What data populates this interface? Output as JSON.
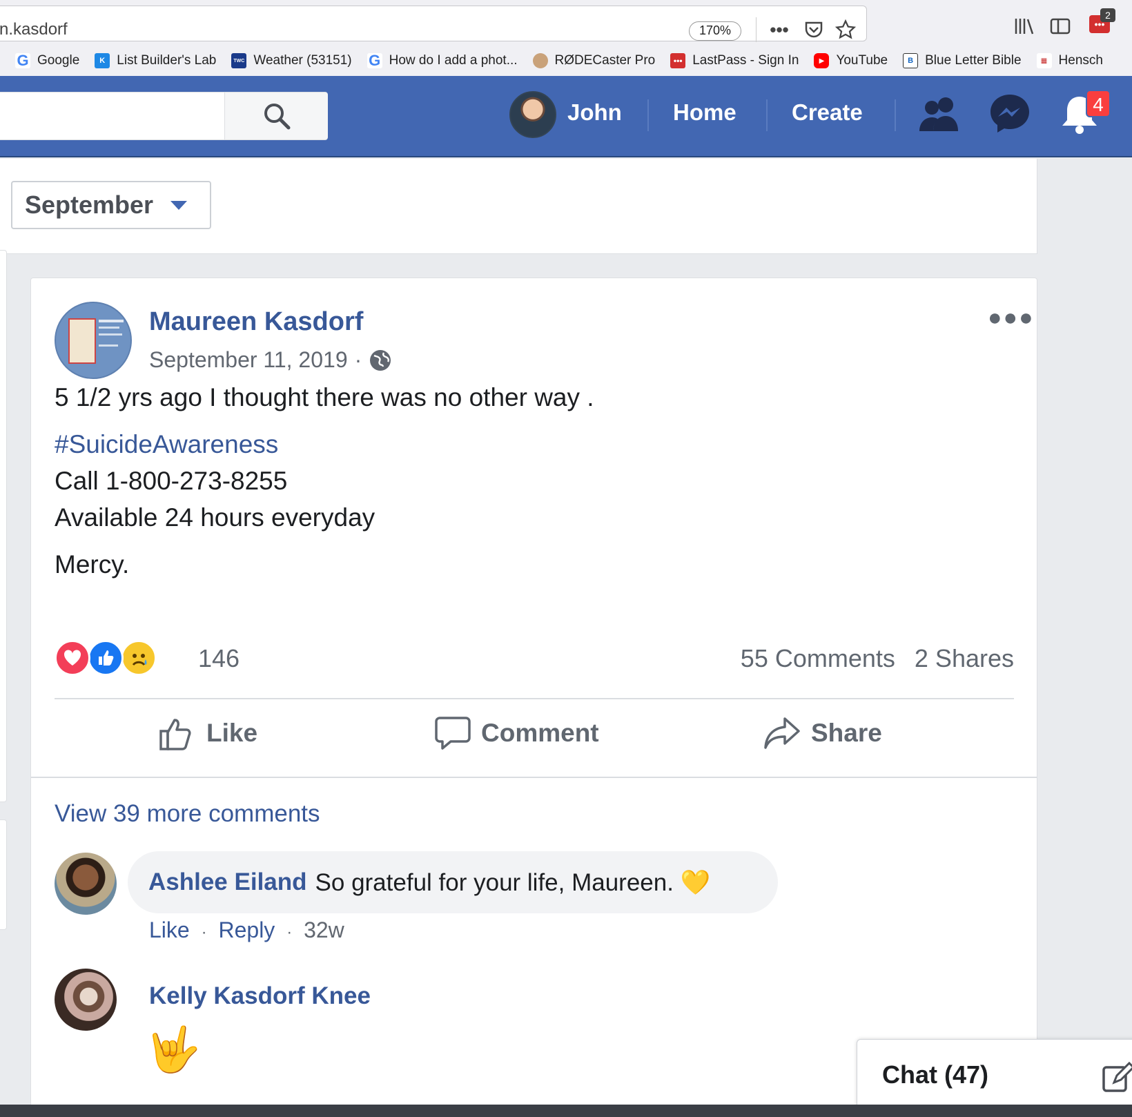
{
  "browser": {
    "url_text": "n.kasdorf",
    "zoom": "170%",
    "extension_badge": "2",
    "bookmarks": [
      {
        "label": "Google",
        "icon": "google-icon"
      },
      {
        "label": "List Builder's Lab",
        "icon": "listbuilder-icon"
      },
      {
        "label": "Weather (53151)",
        "icon": "weather-channel-icon"
      },
      {
        "label": "How do I add a phot...",
        "icon": "google-icon"
      },
      {
        "label": "RØDECaster Pro",
        "icon": "rode-icon"
      },
      {
        "label": "LastPass - Sign In",
        "icon": "lastpass-icon"
      },
      {
        "label": "YouTube",
        "icon": "youtube-icon"
      },
      {
        "label": "Blue Letter Bible",
        "icon": "blueletterbible-icon"
      },
      {
        "label": "Hensch",
        "icon": "hensch-icon"
      }
    ]
  },
  "fb_header": {
    "user_name": "John",
    "home_label": "Home",
    "create_label": "Create",
    "notifications_count": "4",
    "brand_color": "#4267b2"
  },
  "filter": {
    "month_selected": "September"
  },
  "post": {
    "author": "Maureen Kasdorf",
    "date": "September 11, 2019",
    "date_separator": "·",
    "lines": {
      "l1": "5 1/2 yrs ago I thought there was no other way .",
      "hashtag": "#SuicideAwareness",
      "l3": "Call 1-800-273-8255",
      "l4": "Available 24 hours everyday",
      "l5": "Mercy."
    },
    "reactions": {
      "count": "146",
      "types": [
        "love-reaction-icon",
        "like-reaction-icon",
        "sad-reaction-icon"
      ]
    },
    "comments_count": "55 Comments",
    "shares_count": "2 Shares",
    "actions": {
      "like": "Like",
      "comment": "Comment",
      "share": "Share"
    }
  },
  "comments": {
    "view_more": "View 39 more comments",
    "items": [
      {
        "author": "Ashlee Eiland",
        "text": "So grateful for your life, Maureen. 💛",
        "like": "Like",
        "reply": "Reply",
        "sep": "·",
        "age": "32w"
      },
      {
        "author": "Kelly Kasdorf Knee",
        "text": "🤟"
      }
    ]
  },
  "chat": {
    "label": "Chat (47)"
  }
}
